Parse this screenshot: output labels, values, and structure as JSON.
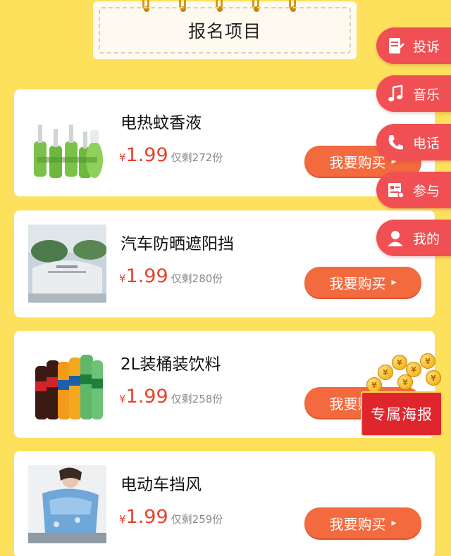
{
  "header": {
    "title": "报名项目"
  },
  "products": [
    {
      "name": "电热蚊香液",
      "currency": "¥",
      "price": "1.99",
      "stock": "仅剩272份",
      "buy_label": "我要购买"
    },
    {
      "name": "汽车防晒遮阳挡",
      "currency": "¥",
      "price": "1.99",
      "stock": "仅剩280份",
      "buy_label": "我要购买"
    },
    {
      "name": "2L装桶装饮料",
      "currency": "¥",
      "price": "1.99",
      "stock": "仅剩258份",
      "buy_label": "我要购买"
    },
    {
      "name": "电动车挡风",
      "currency": "¥",
      "price": "1.99",
      "stock": "仅剩259份",
      "buy_label": "我要购买"
    }
  ],
  "side_menu": [
    {
      "label": "投诉",
      "icon": "document-edit-icon"
    },
    {
      "label": "音乐",
      "icon": "music-note-icon"
    },
    {
      "label": "电话",
      "icon": "phone-icon"
    },
    {
      "label": "参与",
      "icon": "form-icon"
    },
    {
      "label": "我的",
      "icon": "user-icon"
    }
  ],
  "poster": {
    "label": "专属海报",
    "coin_glyph": "¥"
  },
  "colors": {
    "background": "#fde15c",
    "price": "#e8412c",
    "buy_button": "#f26a3e",
    "side_menu": "#f05053",
    "poster": "#e0262d"
  }
}
